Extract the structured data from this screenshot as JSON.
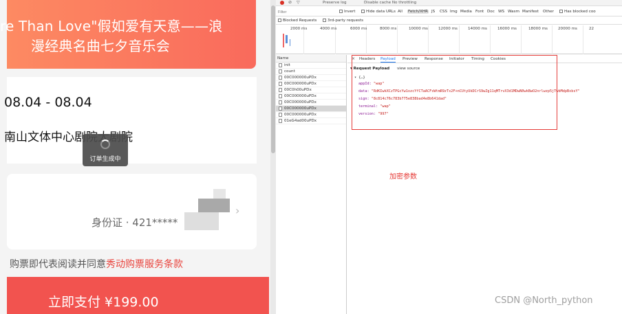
{
  "mobile": {
    "banner_line1": "re Than Love\"假如爱有天意——浪",
    "banner_line2": "漫经典名曲七夕音乐会",
    "date_range": "08.04 - 08.04",
    "venue": "南山文体中心剧院大剧院",
    "toast_text": "订单生成中",
    "id_text": "身份证 · 421*****",
    "agreement_prefix": "购票即代表阅读并同意",
    "agreement_link": "秀动购票服务条款",
    "pay_button": "立即支付 ¥199.00"
  },
  "devtools": {
    "toolbar1_a": "Preserve log",
    "toolbar1_b": "Disable cache  No throttling",
    "filter_placeholder": "Filter",
    "invert": "Invert",
    "hide_data_urls": "Hide data URLs",
    "type_filters": [
      "All",
      "Fetch/XHR",
      "JS",
      "CSS",
      "Img",
      "Media",
      "Font",
      "Doc",
      "WS",
      "Wasm",
      "Manifest",
      "Other"
    ],
    "has_blocked_cookies": "Has blocked coo",
    "blocked_requests": "Blocked Requests",
    "third_party": "3rd-party requests",
    "timeline_ticks": [
      "2000 ms",
      "4000 ms",
      "6000 ms",
      "8000 ms",
      "10000 ms",
      "12000 ms",
      "14000 ms",
      "16000 ms",
      "18000 ms",
      "20000 ms",
      "22"
    ],
    "name_header": "Name",
    "requests": [
      "init",
      "count",
      "00C000000uPDx",
      "00C000000uPDx",
      "00C0h00uPDx",
      "00C000000uPDx",
      "00C000000uPDx",
      "00C000000uPDx",
      "00C000000uPDx",
      "01eG4ad00uPDx"
    ],
    "selected_request_index": 7,
    "close_x": "×",
    "detail_tabs": [
      "Headers",
      "Payload",
      "Preview",
      "Response",
      "Initiator",
      "Timing",
      "Cookies"
    ],
    "active_tab": "Payload",
    "payload_header": "Request Payload",
    "view_source": "view source",
    "obj_line": "▾ {…}",
    "payload": [
      {
        "key": "appId:",
        "value": "\"wap\""
      },
      {
        "key": "data:",
        "value": "\"RdKIwkXCzTPGcYw1ozcYfCTaACFsWtmR9zTx2F+nCUtyUkDCrS9wZg11qMTrvX3d1MDwN0wkBwO2nrlwzp5jTwbMdpBxbsY\""
      },
      {
        "key": "sign:",
        "value": "\"8c814c76c783b775e838bad4e8b641dad\""
      },
      {
        "key": "terminal:",
        "value": "\"wap\""
      },
      {
        "key": "version:",
        "value": "\"997\""
      }
    ]
  },
  "annotation": "加密参数",
  "watermark": "CSDN @North_python",
  "colors": {
    "banner_start": "#fd8a62",
    "banner_end": "#f96a5c",
    "pay_button": "#f2534f",
    "link": "#e9443d",
    "annotation_red": "#e53935",
    "devtools_accent": "#1a73e8"
  }
}
